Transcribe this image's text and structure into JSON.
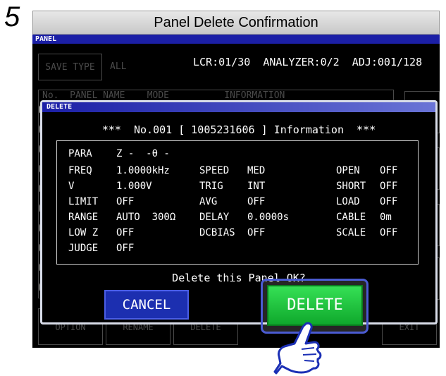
{
  "step": {
    "number": "5"
  },
  "header": {
    "title": "Panel Delete Confirmation"
  },
  "screen": {
    "window_title": "PANEL",
    "save_type_button": "SAVE TYPE",
    "all_label": "ALL",
    "status": "LCR:01/30  ANALYZER:0/2  ADJ:001/128",
    "table_header": "No.  PANEL NAME    MODE          INFORMATION",
    "bottom_buttons": [
      "OPTION",
      "RENAME",
      "DELETE",
      "EXIT"
    ]
  },
  "dialog": {
    "title": "DELETE",
    "headline": "***  No.001 [ 1005231606 ] Information  ***",
    "info": {
      "para_label": "PARA",
      "para_value": "Z -  -θ -",
      "freq_label": "FREQ",
      "freq_value": "1.0000kHz",
      "speed_label": "SPEED",
      "speed_value": "MED",
      "open_label": "OPEN",
      "open_value": "OFF",
      "v_label": "V",
      "v_value": "1.000V",
      "trig_label": "TRIG",
      "trig_value": "INT",
      "short_label": "SHORT",
      "short_value": "OFF",
      "limit_label": "LIMIT",
      "limit_value": "OFF",
      "avg_label": "AVG",
      "avg_value": "OFF",
      "load_label": "LOAD",
      "load_value": "OFF",
      "range_label": "RANGE",
      "range_value": "AUTO  300Ω",
      "delay_label": "DELAY",
      "delay_value": "0.0000s",
      "cable_label": "CABLE",
      "cable_value": "0m",
      "lowz_label": "LOW Z",
      "lowz_value": "OFF",
      "dcbias_label": "DCBIAS",
      "dcbias_value": "OFF",
      "scale_label": "SCALE",
      "scale_value": "OFF",
      "judge_label": "JUDGE",
      "judge_value": "OFF"
    },
    "confirm_text": "Delete this Panel OK?",
    "cancel_label": "CANCEL",
    "delete_label": "DELETE"
  },
  "colors": {
    "title_bar": "#1b1fa6",
    "cancel": "#1c2fb0",
    "delete": "#1fc440",
    "outline": "#4b5bd2"
  },
  "icons": {
    "pointer": "pointing-hand-icon"
  }
}
